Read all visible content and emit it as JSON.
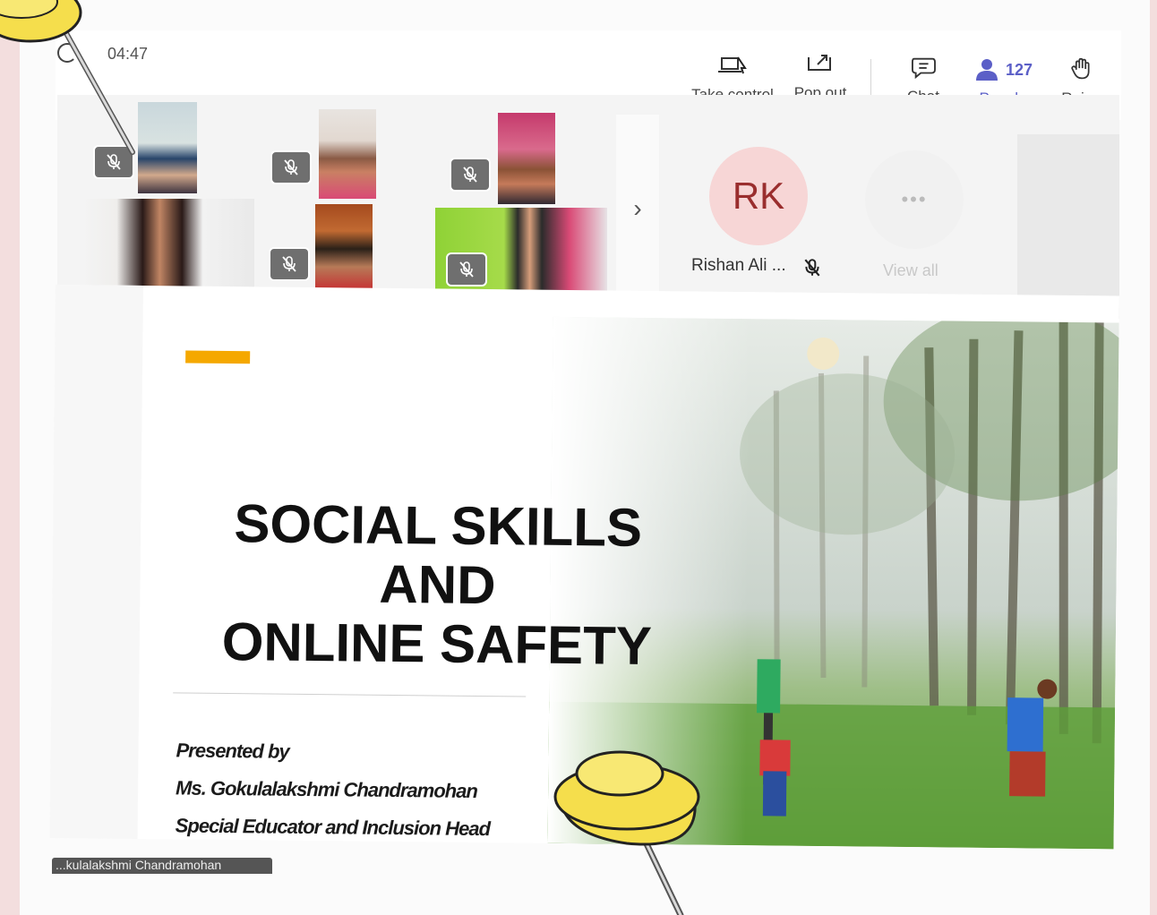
{
  "meeting": {
    "timer": "04:47"
  },
  "toolbar": {
    "take_control": "Take control",
    "pop_out": "Pop out",
    "chat": "Chat",
    "people": "People",
    "people_count": "127",
    "raise": "Raise"
  },
  "participants": {
    "rk_initials": "RK",
    "rk_name": "Rishan Ali ...",
    "view_all": "View all",
    "more_glyph": "•••",
    "next_glyph": "›"
  },
  "slide": {
    "title_line1": "SOCIAL SKILLS",
    "title_line2": "AND",
    "title_line3": "ONLINE SAFETY",
    "presented_by": "Presented by",
    "presenter_name": "Ms. Gokulalakshmi Chandramohan",
    "presenter_role": "Special Educator and Inclusion Head"
  },
  "presenter_tag": "...kulalakshmi Chandramohan",
  "colors": {
    "accent_purple": "#5b5fc7",
    "slide_accent": "#f5a800",
    "avatar_bg": "#f7d6d6",
    "avatar_text": "#9a2e2e",
    "pin_yellow": "#f5de4c"
  },
  "icons": [
    "take-control-icon",
    "pop-out-icon",
    "chat-icon",
    "people-icon",
    "raise-hand-icon",
    "mic-off-icon",
    "chevron-right-icon",
    "thumbtack-icon"
  ]
}
